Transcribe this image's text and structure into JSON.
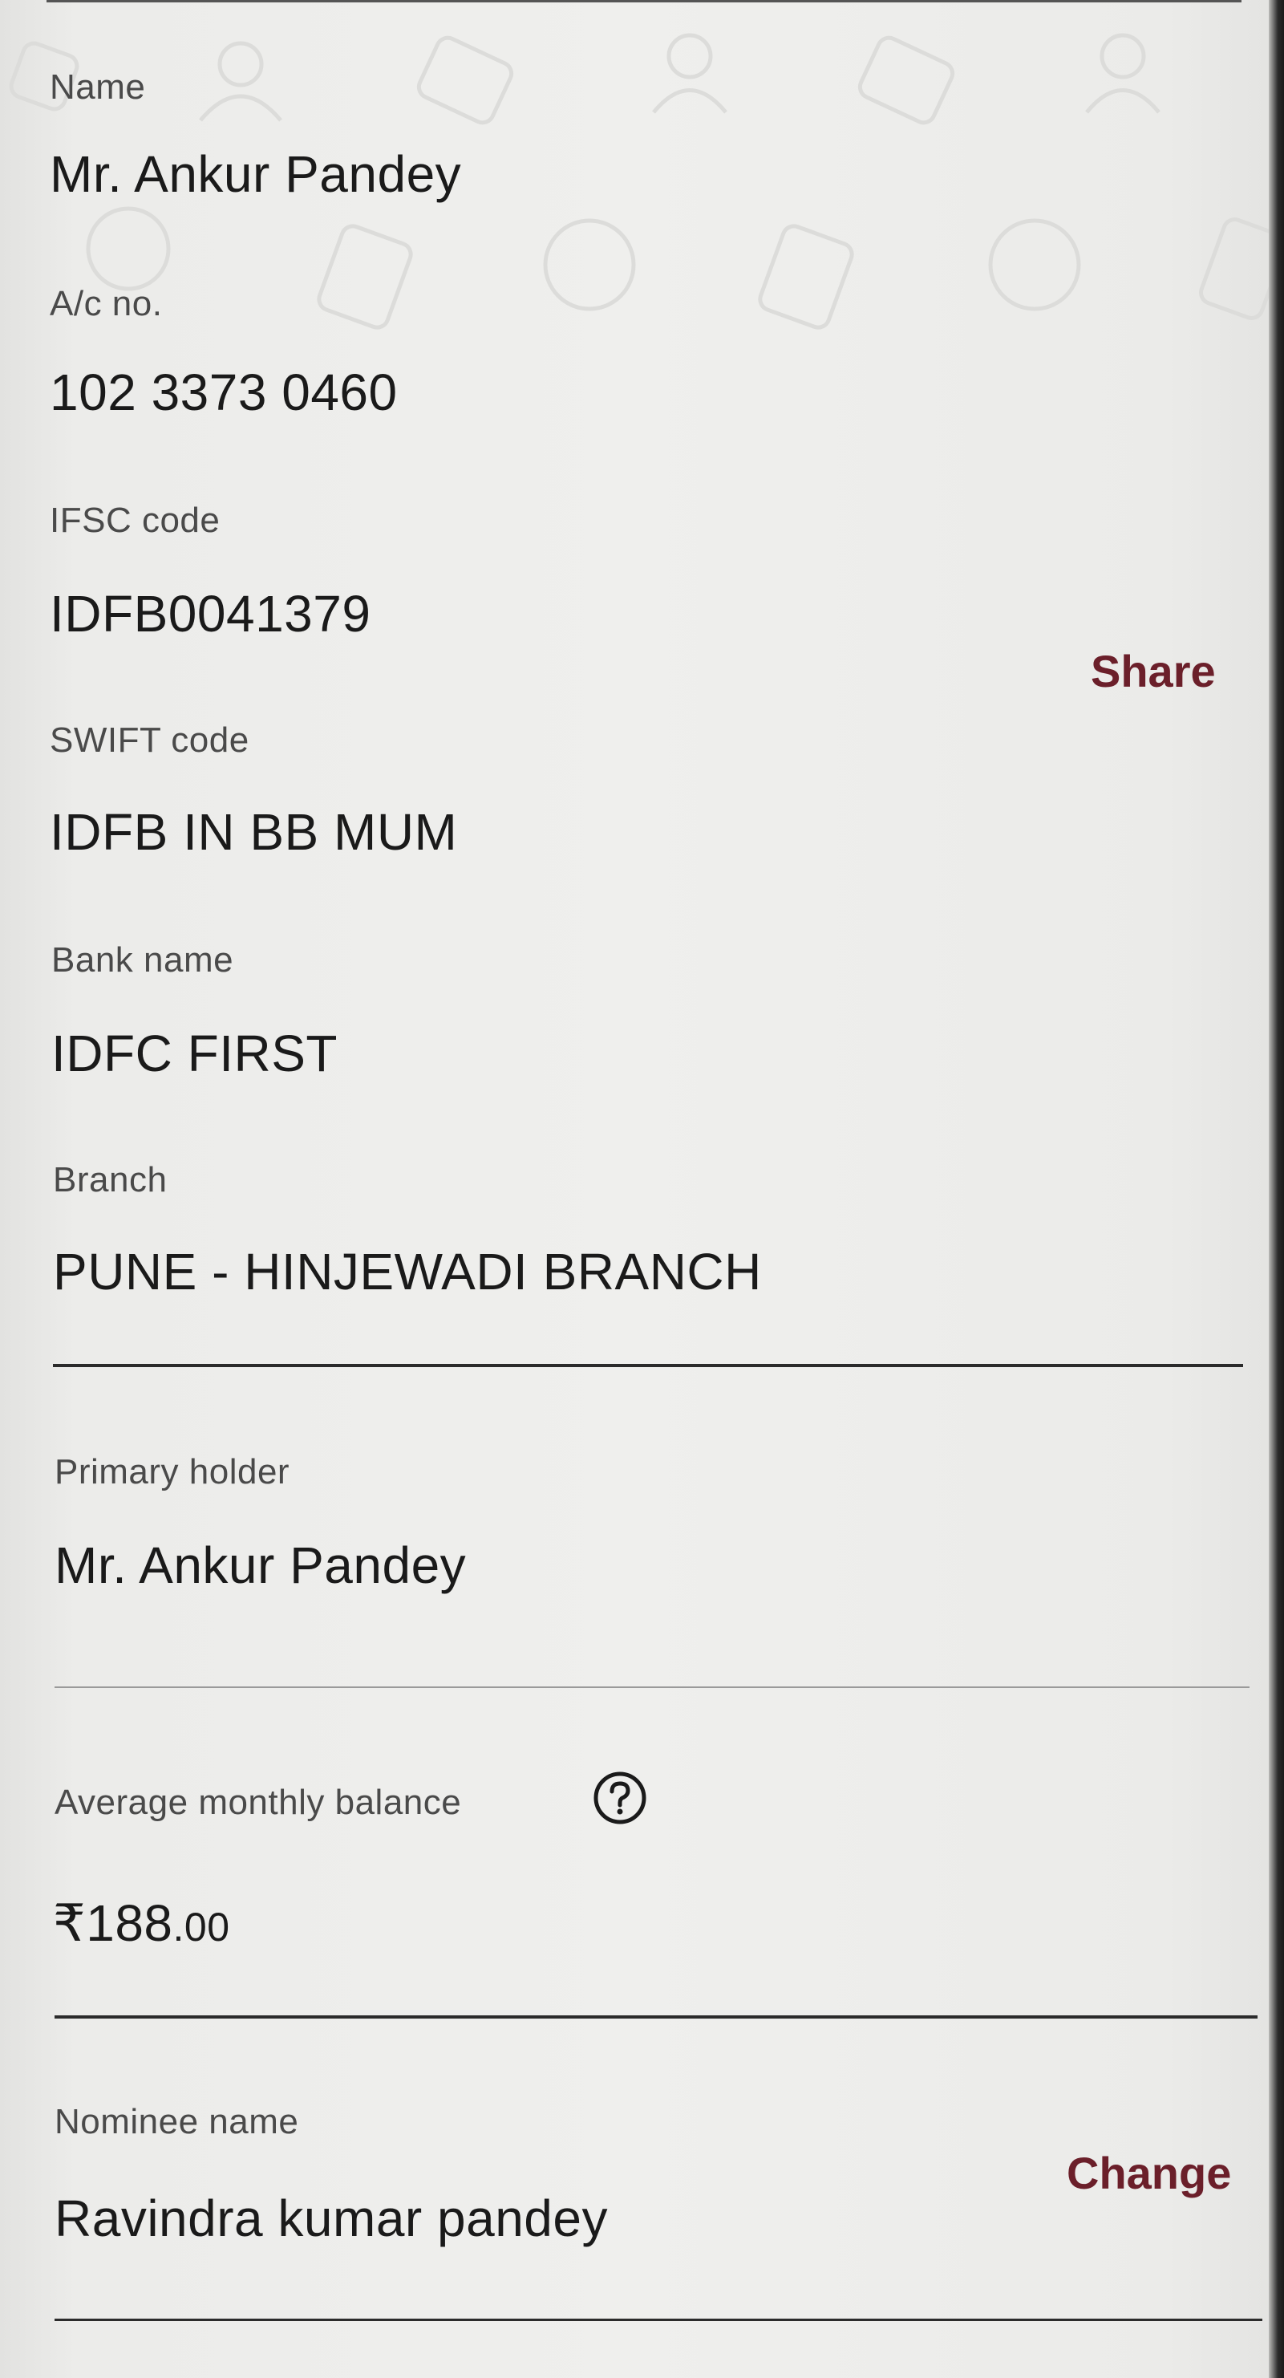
{
  "details": {
    "name_label": "Name",
    "name_value": "Mr. Ankur  Pandey",
    "acno_label": "A/c no.",
    "acno_value": "102 3373 0460",
    "ifsc_label": "IFSC code",
    "ifsc_value": "IDFB0041379",
    "share_label": "Share",
    "swift_label": "SWIFT code",
    "swift_value": "IDFB IN BB MUM",
    "bank_label": "Bank name",
    "bank_value": "IDFC FIRST",
    "branch_label": "Branch",
    "branch_value": "PUNE - HINJEWADI BRANCH"
  },
  "holder": {
    "label": "Primary holder",
    "value": "Mr. Ankur  Pandey"
  },
  "balance": {
    "label": "Average monthly balance",
    "help_icon": "question-circle-icon",
    "amount_main": "₹188",
    "amount_paise": ".00"
  },
  "nominee": {
    "label": "Nominee name",
    "value": "Ravindra kumar pandey",
    "change_label": "Change"
  },
  "colors": {
    "accent": "#6b1f2a",
    "background": "#efefed",
    "text": "#1a1a1a",
    "label_text": "#4a4a4a"
  }
}
